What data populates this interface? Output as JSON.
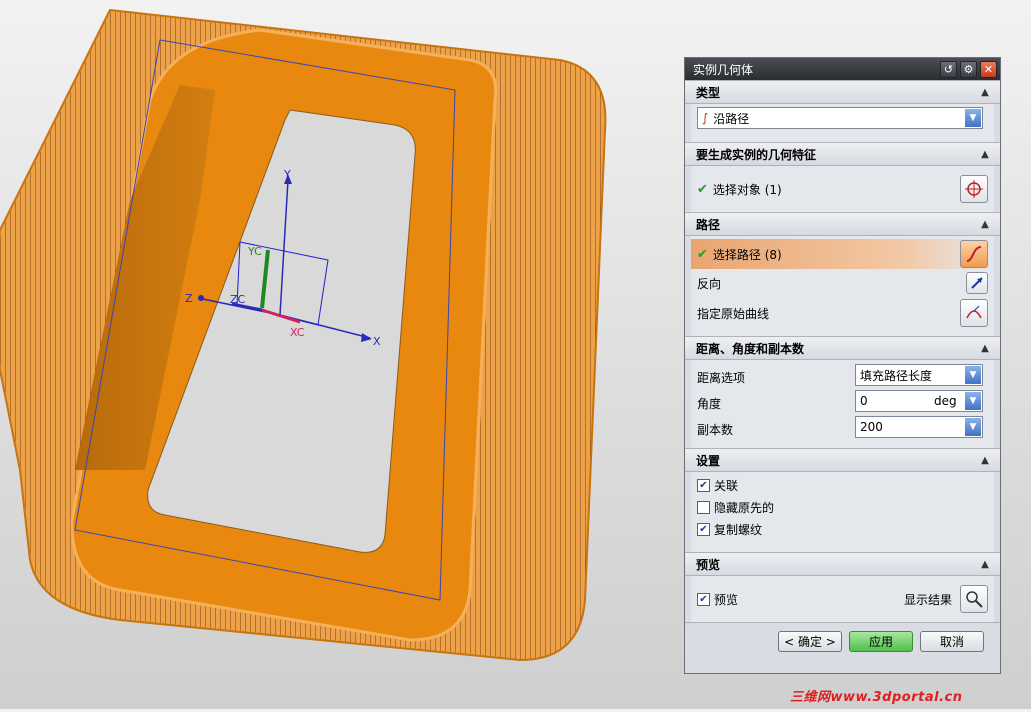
{
  "dialog": {
    "title": "实例几何体",
    "sections": {
      "type": {
        "header": "类型",
        "selected": "沿路径"
      },
      "features": {
        "header": "要生成实例的几何特征",
        "select_label": "选择对象 (1)"
      },
      "path": {
        "header": "路径",
        "select_label": "选择路径 (8)",
        "reverse_label": "反向",
        "origin_label": "指定原始曲线"
      },
      "distance": {
        "header": "距离、角度和副本数",
        "distance_option_label": "距离选项",
        "distance_option_value": "填充路径长度",
        "angle_label": "角度",
        "angle_value": "0",
        "angle_unit": "deg",
        "copies_label": "副本数",
        "copies_value": "200"
      },
      "settings": {
        "header": "设置",
        "associative_label": "关联",
        "associative_checked": true,
        "hide_original_label": "隐藏原先的",
        "hide_original_checked": false,
        "copy_threads_label": "复制螺纹",
        "copy_threads_checked": true
      },
      "preview": {
        "header": "预览",
        "preview_label": "预览",
        "preview_checked": true,
        "show_result_label": "显示结果"
      }
    },
    "buttons": {
      "ok": "< 确定 >",
      "apply": "应用",
      "cancel": "取消"
    }
  },
  "viewport": {
    "axes": {
      "y": "Y",
      "yc": "YC",
      "z": "Z",
      "zc": "ZC",
      "xc": "XC",
      "x": "X"
    },
    "model_color": "#e8880e"
  },
  "watermark": "三维网www.3dportal.cn",
  "colors": {
    "accent_green": "#20a020",
    "highlight_orange": "#e9a570",
    "apply_green": "#5fc95a"
  }
}
